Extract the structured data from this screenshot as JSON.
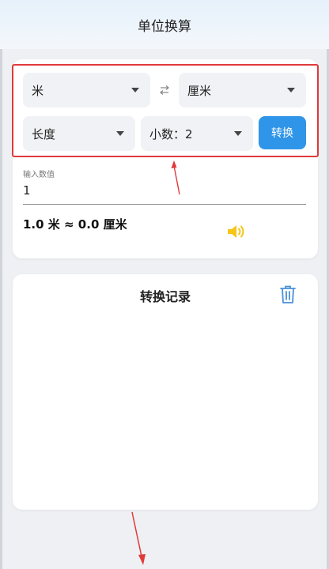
{
  "header": {
    "title": "单位换算"
  },
  "converter": {
    "from_unit": "米",
    "to_unit": "厘米",
    "category": "长度",
    "decimals": "小数：2",
    "convert_label": "转换",
    "input_label": "输入数值",
    "input_value": "1",
    "result": "1.0 米 ≈ 0.0 厘米"
  },
  "history": {
    "title": "转换记录"
  },
  "colors": {
    "accent": "#2f95e8",
    "speaker": "#f5c518",
    "annotation": "#e03a3a"
  },
  "icons": {
    "swap": "swap-icon",
    "speaker": "speaker-icon",
    "trash": "trash-icon"
  }
}
